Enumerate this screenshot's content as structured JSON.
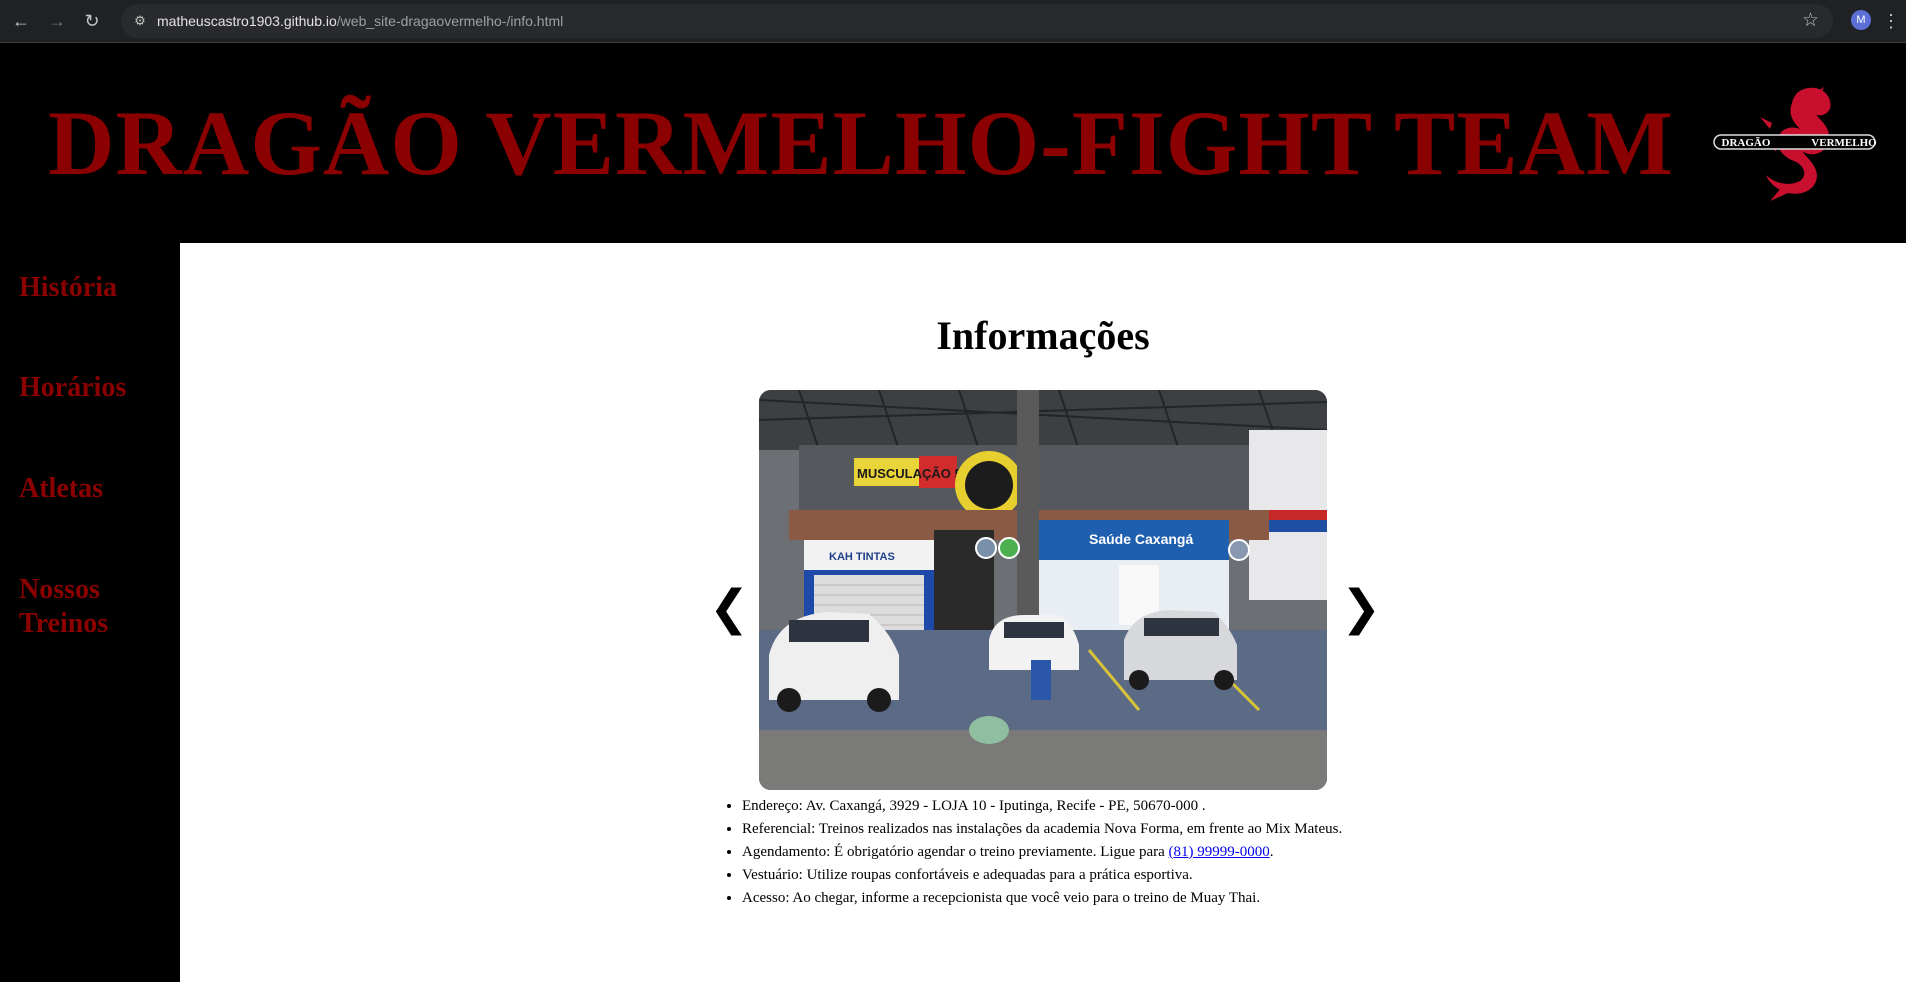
{
  "browser": {
    "url_domain": "matheuscastro1903.github.io",
    "url_path": "/web_site-dragaovermelho-/info.html",
    "profile_initial": "M",
    "icons": {
      "back": "back-arrow-icon",
      "forward": "forward-arrow-icon",
      "reload": "reload-icon",
      "site_info": "site-settings-icon",
      "bookmark": "star-icon",
      "menu": "kebab-menu-icon"
    }
  },
  "header": {
    "title": "DRAGÃO VERMELHO-FIGHT TEAM",
    "logo_left": "DRAGÃO",
    "logo_right": "VERMELHO",
    "title_color": "#8b0000"
  },
  "sidebar": {
    "items": [
      {
        "label": "História"
      },
      {
        "label": "Horários"
      },
      {
        "label": "Atletas"
      },
      {
        "label": "Nossos Treinos"
      }
    ]
  },
  "main": {
    "heading": "Informações",
    "carousel": {
      "prev_label": "❮",
      "next_label": "❯",
      "photo_signs": {
        "gym_banner": "MUSCULAÇÃO 59,90",
        "shop_left": "KAH TINTAS",
        "shop_right": "Saúde Caxangá"
      }
    },
    "info": [
      {
        "text": "Endereço: Av. Caxangá, 3929 - LOJA 10 - Iputinga, Recife - PE, 50670-000 ."
      },
      {
        "text": "Referencial: Treinos realizados nas instalações da academia Nova Forma, em frente ao Mix Mateus."
      },
      {
        "text_before": "Agendamento: É obrigatório agendar o treino previamente. Ligue para ",
        "link": "(81) 99999-0000",
        "text_after": "."
      },
      {
        "text": "Vestuário: Utilize roupas confortáveis e adequadas para a prática esportiva."
      },
      {
        "text": "Acesso: Ao chegar, informe a recepcionista que você veio para o treino de Muay Thai."
      }
    ]
  }
}
